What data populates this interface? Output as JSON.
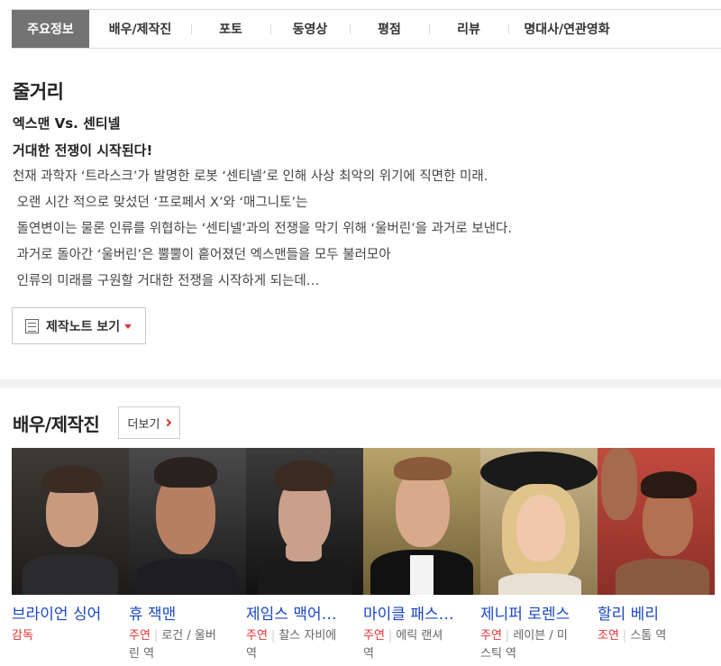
{
  "tabs": [
    {
      "label": "주요정보",
      "active": true
    },
    {
      "label": "배우/제작진"
    },
    {
      "label": "포토"
    },
    {
      "label": "동영상"
    },
    {
      "label": "평점"
    },
    {
      "label": "리뷰"
    },
    {
      "label": "명대사/연관영화"
    }
  ],
  "synopsis": {
    "title": "줄거리",
    "headline1": "엑스맨 Vs. 센티넬",
    "headline2": "거대한 전쟁이 시작된다!",
    "lines": [
      "천재 과학자 ‘트라스크’가 발명한 로봇 ‘센티넬’로 인해 사상 최악의 위기에 직면한 미래.",
      " 오랜 시간 적으로 맞섰던 ‘프로페서 X’와 ‘매그니토’는",
      " 돌연변이는 물론 인류를 위협하는 ‘센티넬’과의 전쟁을 막기 위해 ‘울버린’을 과거로 보낸다.",
      " 과거로 돌아간 ‘울버린’은 뿔뿔이 흩어졌던 엑스맨들을 모두 불러모아",
      " 인류의 미래를 구원할 거대한 전쟁을 시작하게 되는데…"
    ],
    "notes_button": "제작노트 보기"
  },
  "cast_section": {
    "title": "배우/제작진",
    "more_label": "더보기"
  },
  "cast": [
    {
      "name": "브라이언 싱어",
      "role_type": "감독",
      "role_line1": "",
      "role_line2": ""
    },
    {
      "name": "휴 잭맨",
      "role_type": "주연",
      "role_line1": "로건 / 울버",
      "role_line2": "린 역"
    },
    {
      "name": "제임스 맥어…",
      "role_type": "주연",
      "role_line1": "찰스 자비에",
      "role_line2": "역"
    },
    {
      "name": "마이클 패스…",
      "role_type": "주연",
      "role_line1": "에릭 랜셔",
      "role_line2": "역"
    },
    {
      "name": "제니퍼 로렌스",
      "role_type": "주연",
      "role_line1": "레이븐 / 미",
      "role_line2": "스틱 역"
    },
    {
      "name": "할리 베리",
      "role_type": "조연",
      "role_line1": "스톰 역",
      "role_line2": ""
    }
  ],
  "colors": {
    "link_blue": "#1a47c7",
    "accent_red": "#e5312f",
    "active_tab": "#737373"
  }
}
